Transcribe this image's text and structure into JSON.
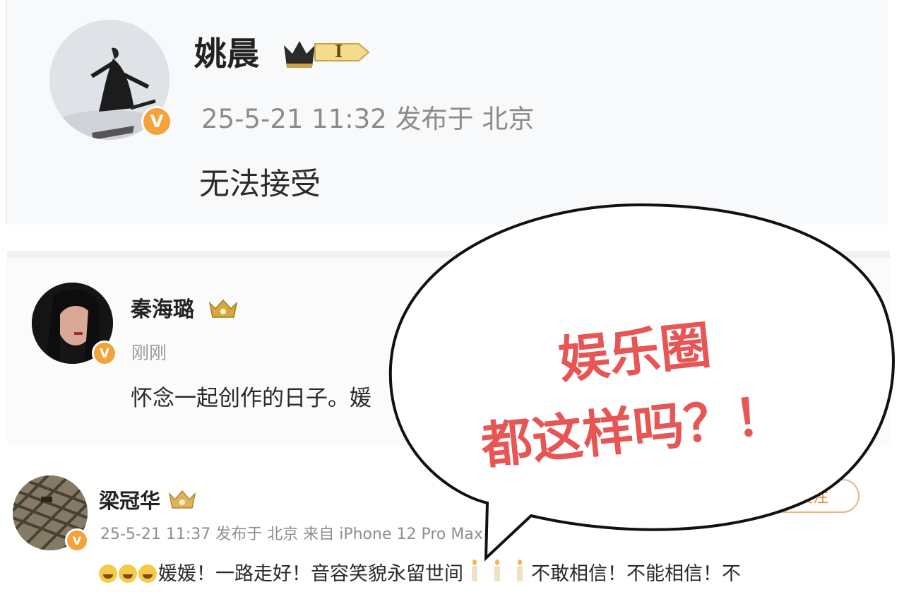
{
  "post1": {
    "name": "姚晨",
    "level": "I",
    "meta": "25-5-21 11:32 发布于 北京",
    "text": "无法接受"
  },
  "post2": {
    "name": "秦海璐",
    "meta": "刚刚",
    "text": "怀念一起创作的日子。媛"
  },
  "post3": {
    "name": "梁冠华",
    "meta": "25-5-21 11:37 发布于 北京 来自 iPhone 12 Pro Max",
    "follow": "关注",
    "text_a": "媛媛！一路走好！音容笑貌永留世间",
    "text_b": "不敢相信！不能相信！不"
  },
  "callout": {
    "line1": "娱乐圈",
    "line2": "都这样吗？！"
  },
  "colors": {
    "callout_text": "#e85555",
    "verified_badge": "#f4a23a",
    "follow_border": "#f2b27a"
  }
}
